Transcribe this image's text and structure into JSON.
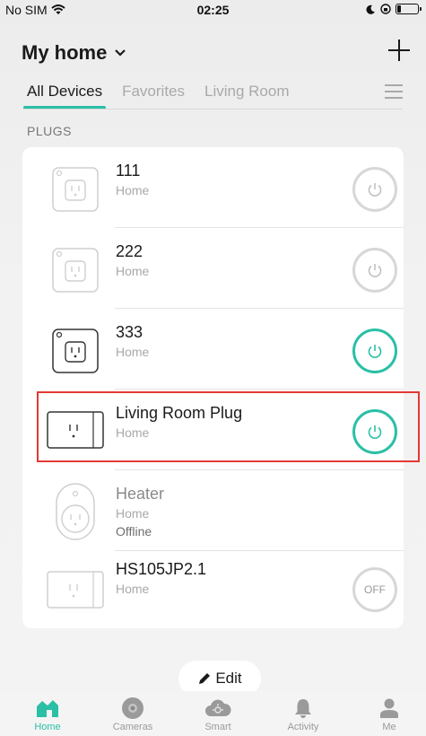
{
  "status_bar": {
    "carrier": "No SIM",
    "time": "02:25",
    "icons": [
      "wifi-icon",
      "moon-icon",
      "lock-rotation-icon",
      "battery-icon"
    ]
  },
  "header": {
    "title": "My home",
    "add_icon": "plus-icon"
  },
  "tabs": [
    {
      "label": "All Devices",
      "active": true
    },
    {
      "label": "Favorites",
      "active": false
    },
    {
      "label": "Living Room",
      "active": false
    }
  ],
  "section_label": "PLUGS",
  "devices": [
    {
      "name": "111",
      "room": "Home",
      "status": "",
      "power": "idle",
      "icon": "plug-icon"
    },
    {
      "name": "222",
      "room": "Home",
      "status": "",
      "power": "idle",
      "icon": "plug-icon"
    },
    {
      "name": "333",
      "room": "Home",
      "status": "",
      "power": "on",
      "icon": "plug-icon"
    },
    {
      "name": "Living Room Plug",
      "room": "Home",
      "status": "",
      "power": "on",
      "icon": "plug-icon"
    },
    {
      "name": "Heater",
      "room": "Home",
      "status": "Offline",
      "power": "none",
      "icon": "round-plug-icon"
    },
    {
      "name": "HS105JP2.1",
      "room": "Home",
      "status": "",
      "power": "off",
      "icon": "plug-icon",
      "power_label": "OFF"
    }
  ],
  "edit_label": "Edit",
  "bottom_nav": [
    {
      "label": "Home",
      "icon": "home-icon",
      "active": true
    },
    {
      "label": "Cameras",
      "icon": "camera-icon",
      "active": false
    },
    {
      "label": "Smart",
      "icon": "smart-cloud-icon",
      "active": false
    },
    {
      "label": "Activity",
      "icon": "bell-icon",
      "active": false
    },
    {
      "label": "Me",
      "icon": "person-icon",
      "active": false
    }
  ],
  "colors": {
    "accent": "#2bbfa6",
    "highlight": "#e53935"
  }
}
